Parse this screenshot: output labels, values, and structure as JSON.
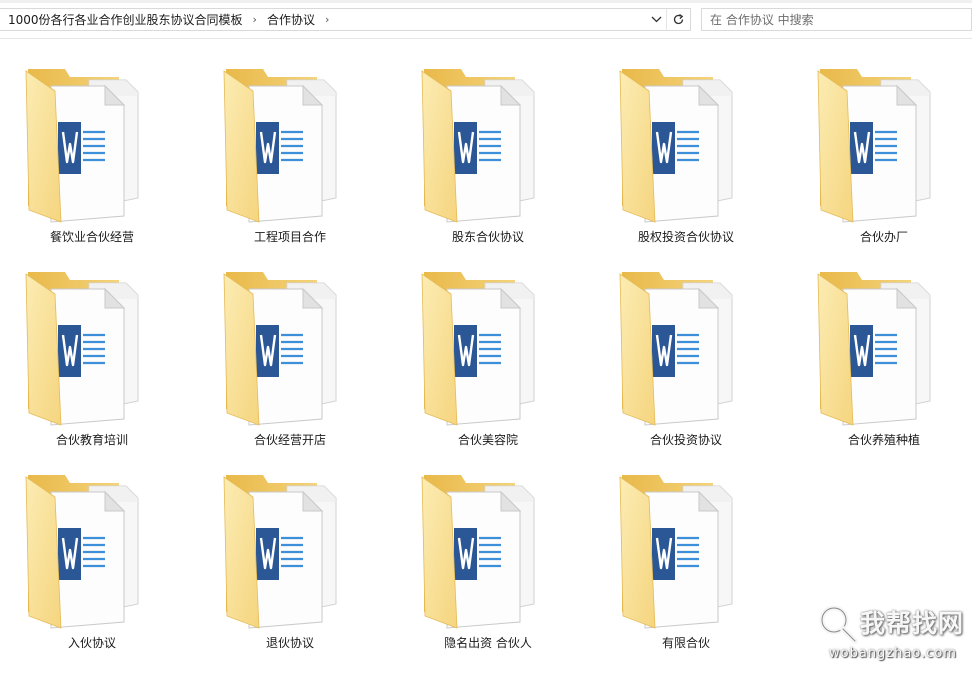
{
  "address_bar": {
    "breadcrumbs": [
      "1000份各行各业合作创业股东协议合同模板",
      "合作协议"
    ],
    "separator": "›",
    "dropdown_icon": "chevron-down-icon",
    "refresh_icon": "refresh-icon"
  },
  "search": {
    "placeholder": "在 合作协议 中搜索",
    "icon": "search-icon"
  },
  "folders": [
    {
      "name": "餐饮业合伙经营"
    },
    {
      "name": "工程项目合作"
    },
    {
      "name": "股东合伙协议"
    },
    {
      "name": "股权投资合伙协议"
    },
    {
      "name": "合伙办厂"
    },
    {
      "name": "合伙教育培训"
    },
    {
      "name": "合伙经营开店"
    },
    {
      "name": "合伙美容院"
    },
    {
      "name": "合伙投资协议"
    },
    {
      "name": "合伙养殖种植"
    },
    {
      "name": "入伙协议"
    },
    {
      "name": "退伙协议"
    },
    {
      "name": "隐名出资 合伙人"
    },
    {
      "name": "有限合伙"
    }
  ],
  "colors": {
    "folder_back": "#f2cc66",
    "folder_front": "#fde7a2",
    "word_blue": "#2b5797",
    "doc_lines": "#3c8fd8"
  },
  "watermark": {
    "name": "我帮找网",
    "url": "wobangzhao.com"
  }
}
